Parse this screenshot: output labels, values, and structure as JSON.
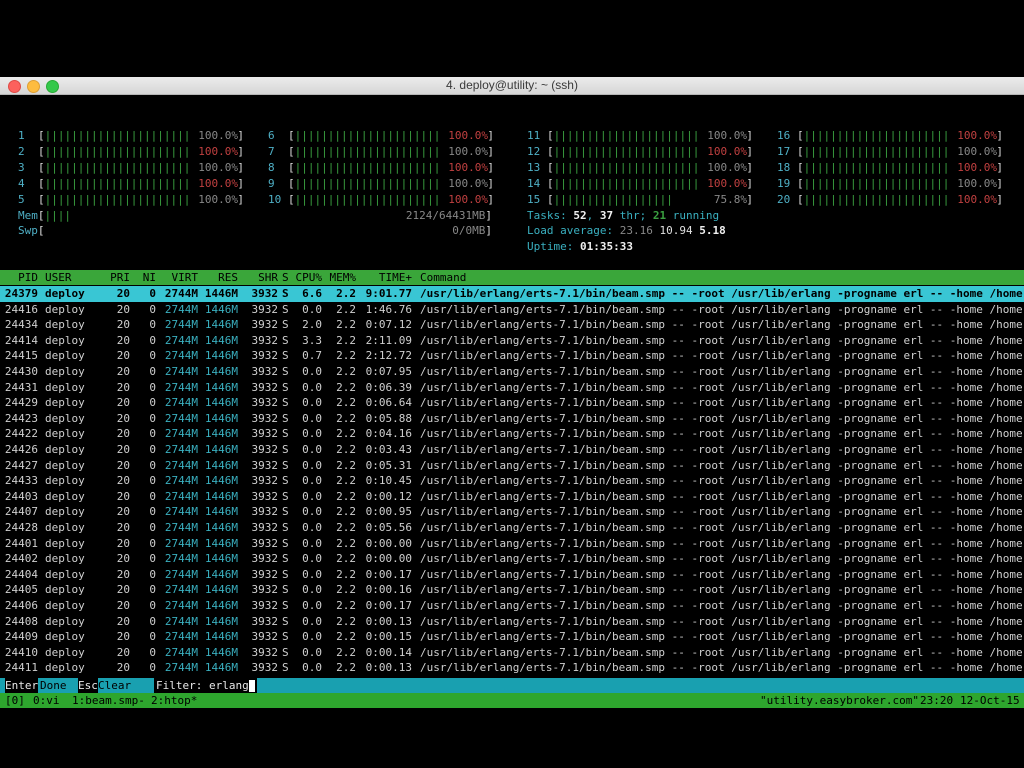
{
  "window": {
    "title": "4. deploy@utility: ~ (ssh)",
    "colors": {
      "close": "#fc615d",
      "minimize": "#fdbc40",
      "maximize": "#34c84a"
    }
  },
  "cpu_meters": [
    {
      "num": "1",
      "bars": "||||||||||||||||||||||",
      "pct": "100.0%"
    },
    {
      "num": "2",
      "bars": "||||||||||||||||||||||",
      "pct": "100.0%"
    },
    {
      "num": "3",
      "bars": "||||||||||||||||||||||",
      "pct": "100.0%"
    },
    {
      "num": "4",
      "bars": "||||||||||||||||||||||",
      "pct": "100.0%"
    },
    {
      "num": "5",
      "bars": "||||||||||||||||||||||",
      "pct": "100.0%"
    },
    {
      "num": "6",
      "bars": "||||||||||||||||||||||",
      "pct": "100.0%"
    },
    {
      "num": "7",
      "bars": "||||||||||||||||||||||",
      "pct": "100.0%"
    },
    {
      "num": "8",
      "bars": "||||||||||||||||||||||",
      "pct": "100.0%"
    },
    {
      "num": "9",
      "bars": "||||||||||||||||||||||",
      "pct": "100.0%"
    },
    {
      "num": "10",
      "bars": "||||||||||||||||||||||",
      "pct": "100.0%"
    },
    {
      "num": "11",
      "bars": "||||||||||||||||||||||",
      "pct": "100.0%"
    },
    {
      "num": "12",
      "bars": "||||||||||||||||||||||",
      "pct": "100.0%"
    },
    {
      "num": "13",
      "bars": "||||||||||||||||||||||",
      "pct": "100.0%"
    },
    {
      "num": "14",
      "bars": "||||||||||||||||||||||",
      "pct": "100.0%"
    },
    {
      "num": "15",
      "bars": "||||||||||||||||||",
      "pct": "75.8%"
    },
    {
      "num": "16",
      "bars": "||||||||||||||||||||||",
      "pct": "100.0%"
    },
    {
      "num": "17",
      "bars": "||||||||||||||||||||||",
      "pct": "100.0%"
    },
    {
      "num": "18",
      "bars": "||||||||||||||||||||||",
      "pct": "100.0%"
    },
    {
      "num": "19",
      "bars": "||||||||||||||||||||||",
      "pct": "100.0%"
    },
    {
      "num": "20",
      "bars": "||||||||||||||||||||||",
      "pct": "100.0%"
    }
  ],
  "mem": {
    "label": "Mem",
    "bars": "||||",
    "value": "2124/64431MB"
  },
  "swp": {
    "label": "Swp",
    "value": "0/0MB"
  },
  "tasks": {
    "label": "Tasks:",
    "count": "52",
    "sep1": ",",
    "thr": "37",
    "thr_label": "thr;",
    "running": "21",
    "running_label": "running"
  },
  "load": {
    "label": "Load average:",
    "v1": "23.16",
    "v2": "10.94",
    "v3": "5.18"
  },
  "uptime": {
    "label": "Uptime:",
    "value": "01:35:33"
  },
  "table": {
    "headers": {
      "pid": "PID",
      "user": "USER",
      "pri": "PRI",
      "ni": "NI",
      "virt": "VIRT",
      "res": "RES",
      "shr": "SHR",
      "s": "S",
      "cpu": "CPU%",
      "mem": "MEM%",
      "time": "TIME+",
      "command": "Command"
    },
    "command": "/usr/lib/erlang/erts-7.1/bin/beam.smp -- -root /usr/lib/erlang -progname erl -- -home /home",
    "rows": [
      {
        "pid": "24379",
        "user": "deploy",
        "pri": "20",
        "ni": "0",
        "virt": "2744M",
        "res": "1446M",
        "shr": "3932",
        "s": "S",
        "cpu": "6.6",
        "mem": "2.2",
        "time": "9:01.77",
        "selected": true
      },
      {
        "pid": "24416",
        "user": "deploy",
        "pri": "20",
        "ni": "0",
        "virt": "2744M",
        "res": "1446M",
        "shr": "3932",
        "s": "S",
        "cpu": "0.0",
        "mem": "2.2",
        "time": "1:46.76"
      },
      {
        "pid": "24434",
        "user": "deploy",
        "pri": "20",
        "ni": "0",
        "virt": "2744M",
        "res": "1446M",
        "shr": "3932",
        "s": "S",
        "cpu": "2.0",
        "mem": "2.2",
        "time": "0:07.12"
      },
      {
        "pid": "24414",
        "user": "deploy",
        "pri": "20",
        "ni": "0",
        "virt": "2744M",
        "res": "1446M",
        "shr": "3932",
        "s": "S",
        "cpu": "3.3",
        "mem": "2.2",
        "time": "2:11.09"
      },
      {
        "pid": "24415",
        "user": "deploy",
        "pri": "20",
        "ni": "0",
        "virt": "2744M",
        "res": "1446M",
        "shr": "3932",
        "s": "S",
        "cpu": "0.7",
        "mem": "2.2",
        "time": "2:12.72"
      },
      {
        "pid": "24430",
        "user": "deploy",
        "pri": "20",
        "ni": "0",
        "virt": "2744M",
        "res": "1446M",
        "shr": "3932",
        "s": "S",
        "cpu": "0.0",
        "mem": "2.2",
        "time": "0:07.95"
      },
      {
        "pid": "24431",
        "user": "deploy",
        "pri": "20",
        "ni": "0",
        "virt": "2744M",
        "res": "1446M",
        "shr": "3932",
        "s": "S",
        "cpu": "0.0",
        "mem": "2.2",
        "time": "0:06.39"
      },
      {
        "pid": "24429",
        "user": "deploy",
        "pri": "20",
        "ni": "0",
        "virt": "2744M",
        "res": "1446M",
        "shr": "3932",
        "s": "S",
        "cpu": "0.0",
        "mem": "2.2",
        "time": "0:06.64"
      },
      {
        "pid": "24423",
        "user": "deploy",
        "pri": "20",
        "ni": "0",
        "virt": "2744M",
        "res": "1446M",
        "shr": "3932",
        "s": "S",
        "cpu": "0.0",
        "mem": "2.2",
        "time": "0:05.88"
      },
      {
        "pid": "24422",
        "user": "deploy",
        "pri": "20",
        "ni": "0",
        "virt": "2744M",
        "res": "1446M",
        "shr": "3932",
        "s": "S",
        "cpu": "0.0",
        "mem": "2.2",
        "time": "0:04.16"
      },
      {
        "pid": "24426",
        "user": "deploy",
        "pri": "20",
        "ni": "0",
        "virt": "2744M",
        "res": "1446M",
        "shr": "3932",
        "s": "S",
        "cpu": "0.0",
        "mem": "2.2",
        "time": "0:03.43"
      },
      {
        "pid": "24427",
        "user": "deploy",
        "pri": "20",
        "ni": "0",
        "virt": "2744M",
        "res": "1446M",
        "shr": "3932",
        "s": "S",
        "cpu": "0.0",
        "mem": "2.2",
        "time": "0:05.31"
      },
      {
        "pid": "24433",
        "user": "deploy",
        "pri": "20",
        "ni": "0",
        "virt": "2744M",
        "res": "1446M",
        "shr": "3932",
        "s": "S",
        "cpu": "0.0",
        "mem": "2.2",
        "time": "0:10.45"
      },
      {
        "pid": "24403",
        "user": "deploy",
        "pri": "20",
        "ni": "0",
        "virt": "2744M",
        "res": "1446M",
        "shr": "3932",
        "s": "S",
        "cpu": "0.0",
        "mem": "2.2",
        "time": "0:00.12"
      },
      {
        "pid": "24407",
        "user": "deploy",
        "pri": "20",
        "ni": "0",
        "virt": "2744M",
        "res": "1446M",
        "shr": "3932",
        "s": "S",
        "cpu": "0.0",
        "mem": "2.2",
        "time": "0:00.95"
      },
      {
        "pid": "24428",
        "user": "deploy",
        "pri": "20",
        "ni": "0",
        "virt": "2744M",
        "res": "1446M",
        "shr": "3932",
        "s": "S",
        "cpu": "0.0",
        "mem": "2.2",
        "time": "0:05.56"
      },
      {
        "pid": "24401",
        "user": "deploy",
        "pri": "20",
        "ni": "0",
        "virt": "2744M",
        "res": "1446M",
        "shr": "3932",
        "s": "S",
        "cpu": "0.0",
        "mem": "2.2",
        "time": "0:00.00"
      },
      {
        "pid": "24402",
        "user": "deploy",
        "pri": "20",
        "ni": "0",
        "virt": "2744M",
        "res": "1446M",
        "shr": "3932",
        "s": "S",
        "cpu": "0.0",
        "mem": "2.2",
        "time": "0:00.00"
      },
      {
        "pid": "24404",
        "user": "deploy",
        "pri": "20",
        "ni": "0",
        "virt": "2744M",
        "res": "1446M",
        "shr": "3932",
        "s": "S",
        "cpu": "0.0",
        "mem": "2.2",
        "time": "0:00.17"
      },
      {
        "pid": "24405",
        "user": "deploy",
        "pri": "20",
        "ni": "0",
        "virt": "2744M",
        "res": "1446M",
        "shr": "3932",
        "s": "S",
        "cpu": "0.0",
        "mem": "2.2",
        "time": "0:00.16"
      },
      {
        "pid": "24406",
        "user": "deploy",
        "pri": "20",
        "ni": "0",
        "virt": "2744M",
        "res": "1446M",
        "shr": "3932",
        "s": "S",
        "cpu": "0.0",
        "mem": "2.2",
        "time": "0:00.17"
      },
      {
        "pid": "24408",
        "user": "deploy",
        "pri": "20",
        "ni": "0",
        "virt": "2744M",
        "res": "1446M",
        "shr": "3932",
        "s": "S",
        "cpu": "0.0",
        "mem": "2.2",
        "time": "0:00.13"
      },
      {
        "pid": "24409",
        "user": "deploy",
        "pri": "20",
        "ni": "0",
        "virt": "2744M",
        "res": "1446M",
        "shr": "3932",
        "s": "S",
        "cpu": "0.0",
        "mem": "2.2",
        "time": "0:00.15"
      },
      {
        "pid": "24410",
        "user": "deploy",
        "pri": "20",
        "ni": "0",
        "virt": "2744M",
        "res": "1446M",
        "shr": "3932",
        "s": "S",
        "cpu": "0.0",
        "mem": "2.2",
        "time": "0:00.14"
      },
      {
        "pid": "24411",
        "user": "deploy",
        "pri": "20",
        "ni": "0",
        "virt": "2744M",
        "res": "1446M",
        "shr": "3932",
        "s": "S",
        "cpu": "0.0",
        "mem": "2.2",
        "time": "0:00.13"
      }
    ]
  },
  "footer": {
    "enter_key": "Enter",
    "enter_label": "Done",
    "esc_key": "Esc",
    "esc_label": "Clear",
    "filter_label": "Filter:",
    "filter_value": "erlang"
  },
  "tmux": {
    "session": "[0]",
    "win0": "0:vi",
    "win1": "1:beam.smp-",
    "win2": "2:htop*",
    "host": "\"utility.easybroker.com\"",
    "time": "23:20",
    "date": "12-Oct-15"
  }
}
